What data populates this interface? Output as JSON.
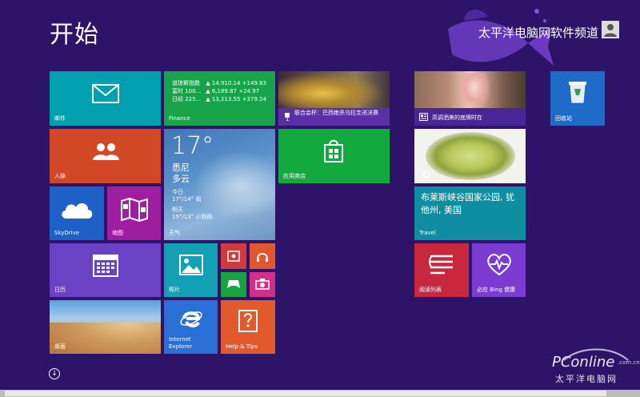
{
  "screen": {
    "title": "开始"
  },
  "user": {
    "name": "太平洋电脑网软件频道"
  },
  "tiles": {
    "mail": "邮件",
    "people": "人脉",
    "skydrive": "SkyDrive",
    "maps": "地图",
    "calendar": "日历",
    "desktop": "桌面",
    "finance": {
      "label": "Finance",
      "rows": [
        {
          "name": "道琼斯指数",
          "value": "▲ 14,910.14 +149.83"
        },
        {
          "name": "富时 100...",
          "value": "▲ 6,189.87 +24.97"
        },
        {
          "name": "日经 225...",
          "value": "▲ 13,213.55 +379.54"
        }
      ]
    },
    "weather": {
      "label": "天气",
      "temp": "17°",
      "city": "悉尼",
      "condition": "多云",
      "today_label": "今日",
      "today": "17°/14° 雨",
      "tomorrow_label": "明天",
      "tomorrow": "15°/13° 小到雨"
    },
    "photos": "照片",
    "ie": "Internet Explorer",
    "help": "Help & Tips",
    "sports_news": "联合会杯：巴西绝杀乌拉圭进决赛",
    "store": "应用商店",
    "news_headline": "高调洒美的底牌时在",
    "travel": {
      "headline": "布莱斯峡谷国家公园, 犹他州, 美国",
      "label": "Travel"
    },
    "reading_list": "阅读列表",
    "health": "必应 Bing 健康",
    "recycle_bin": "回收站"
  },
  "watermark": {
    "brand": "PConline",
    "domain": ".com.cn",
    "sub": "太平洋电脑网"
  },
  "colors": {
    "background": "#2e1469",
    "mail": "#00a0b1",
    "people": "#d24726",
    "skydrive": "#1f5fc8",
    "maps": "#9f1d9f",
    "calendar": "#6b42c6",
    "finance": "#16a34a",
    "store": "#12a93f",
    "photos": "#14a0b4",
    "ie": "#2a6fd6",
    "help": "#e05a2b",
    "small_red": "#d03a3a",
    "small_orange": "#e2572e",
    "small_green": "#18a341",
    "small_pink": "#d0308a",
    "reading": "#c8273e",
    "health": "#7b3bd0",
    "travel": "#0e8ea0",
    "recycle": "#1e6cc8"
  }
}
